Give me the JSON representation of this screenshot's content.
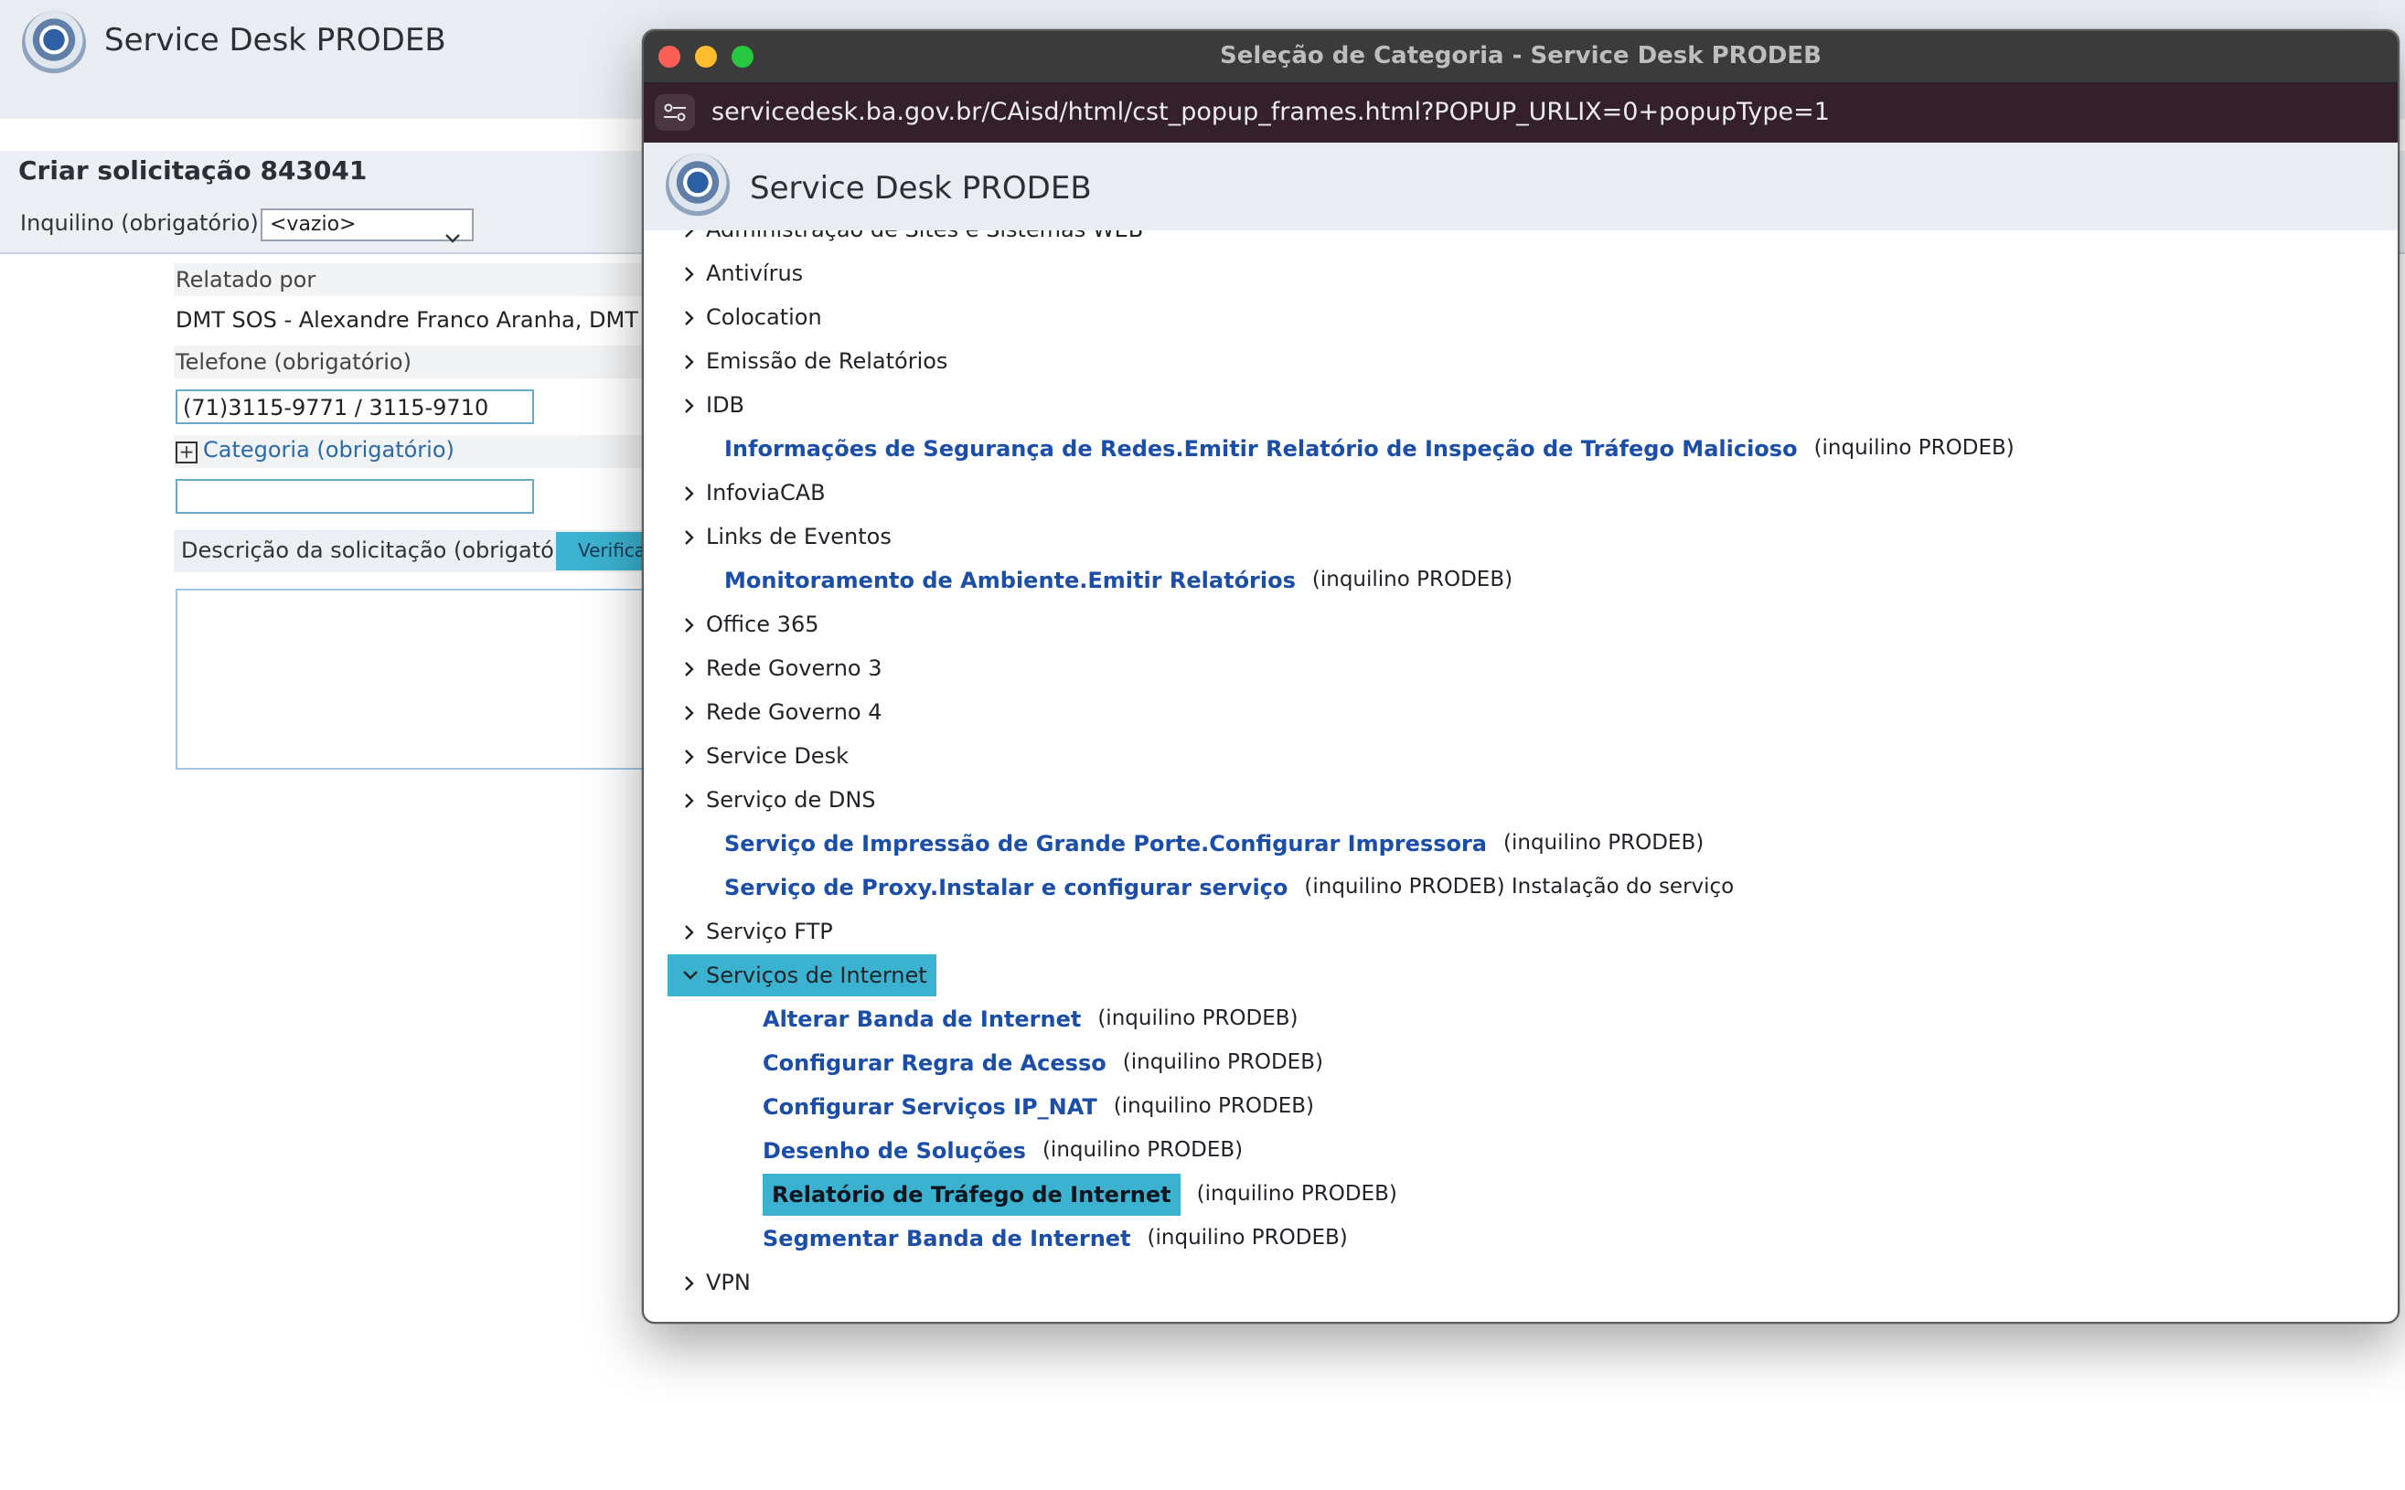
{
  "background_page": {
    "app_title": "Service Desk PRODEB",
    "form_title": "Criar solicitação 843041",
    "tenant_label": "Inquilino (obrigatório)",
    "tenant_value": "<vazio>",
    "reported_by_label": "Relatado por",
    "reported_by_value": "DMT SOS - Alexandre Franco Aranha, DMT - Sec",
    "phone_label": "Telefone (obrigatório)",
    "phone_value": "(71)3115-9771 / 3115-9710",
    "category_label": "Categoria (obrigatório)",
    "category_expand_glyph": "+",
    "category_value": "",
    "description_label": "Descrição da solicitação (obrigatório)",
    "verify_button_label": "Verifica"
  },
  "popup": {
    "window_title": "Seleção de Categoria - Service Desk PRODEB",
    "url": "servicedesk.ba.gov.br/CAisd/html/cst_popup_frames.html?POPUP_URLIX=0+popupType=1",
    "header_title": "Service Desk PRODEB",
    "tree": [
      {
        "label": "Administração de Sites e Sistemas WEB"
      },
      {
        "label": "Antivírus"
      },
      {
        "label": "Colocation"
      },
      {
        "label": "Emissão de Relatórios"
      },
      {
        "label": "IDB"
      },
      {
        "link": "Informações de Segurança de Redes.Emitir Relatório de Inspeção de Tráfego Malicioso",
        "tenant": "(inquilino PRODEB)"
      },
      {
        "label": "InfoviaCAB"
      },
      {
        "label": "Links de Eventos"
      },
      {
        "link": "Monitoramento de Ambiente.Emitir Relatórios",
        "tenant": "(inquilino PRODEB)"
      },
      {
        "label": "Office 365"
      },
      {
        "label": "Rede Governo 3"
      },
      {
        "label": "Rede Governo 4"
      },
      {
        "label": "Service Desk"
      },
      {
        "label": "Serviço de DNS"
      },
      {
        "link": "Serviço de Impressão de Grande Porte.Configurar Impressora",
        "tenant": "(inquilino PRODEB)"
      },
      {
        "link": "Serviço de Proxy.Instalar e configurar serviço",
        "tenant": "(inquilino PRODEB) Instalação do serviço"
      },
      {
        "label": "Serviço FTP"
      },
      {
        "label": "Serviços de Internet",
        "expanded": true,
        "selected": true
      },
      {
        "link": "Alterar Banda de Internet",
        "tenant": "(inquilino PRODEB)",
        "child": true
      },
      {
        "link": "Configurar Regra de Acesso",
        "tenant": "(inquilino PRODEB)",
        "child": true
      },
      {
        "link": "Configurar Serviços IP_NAT",
        "tenant": "(inquilino PRODEB)",
        "child": true
      },
      {
        "link": "Desenho de Soluções",
        "tenant": "(inquilino PRODEB)",
        "child": true
      },
      {
        "link": "Relatório de Tráfego de Internet",
        "tenant": "(inquilino PRODEB)",
        "child": true,
        "selected": true
      },
      {
        "link": "Segmentar Banda de Internet",
        "tenant": "(inquilino PRODEB)",
        "child": true
      },
      {
        "label": "VPN"
      }
    ]
  },
  "colors": {
    "accent": "#3bb2d0",
    "link": "#1a4ea8",
    "header_bg": "#e9edf2",
    "titlebar": "#3b3b3b",
    "urlbar": "#33202a"
  }
}
